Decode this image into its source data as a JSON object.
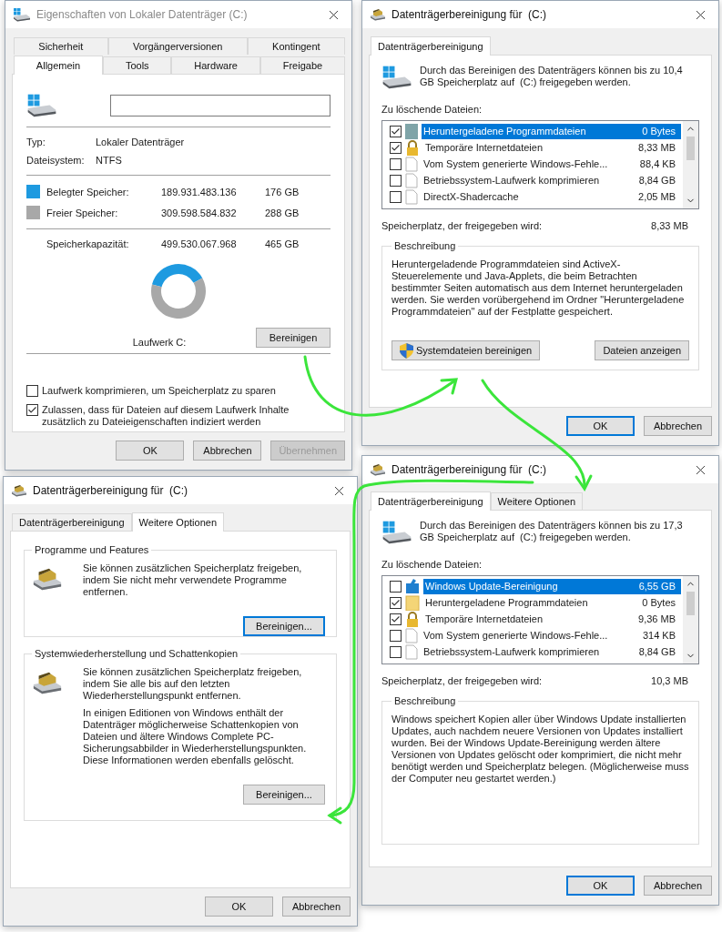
{
  "windows": [
    {
      "kind": "properties",
      "title": "Eigenschaften von Lokaler Datenträger (C:)",
      "tab_rows": [
        [
          {
            "label": "Sicherheit",
            "selected": false
          },
          {
            "label": "Vorgängerversionen",
            "selected": false
          },
          {
            "label": "Kontingent",
            "selected": false
          }
        ],
        [
          {
            "label": "Allgemein",
            "selected": true
          },
          {
            "label": "Tools",
            "selected": false
          },
          {
            "label": "Hardware",
            "selected": false
          },
          {
            "label": "Freigabe",
            "selected": false
          }
        ]
      ],
      "info": [
        {
          "label": "Typ:",
          "value": "Lokaler Datenträger"
        },
        {
          "label": "Dateisystem:",
          "value": "NTFS"
        }
      ],
      "usage": [
        {
          "label": "Belegter Speicher:",
          "color": "#1e9ae0",
          "bytes": "189.931.483.136",
          "size": "176 GB"
        },
        {
          "label": "Freier Speicher:",
          "color": "#a8a8a8",
          "bytes": "309.598.584.832",
          "size": "288 GB"
        }
      ],
      "capacity": {
        "label": "Speicherkapazität:",
        "bytes": "499.530.067.968",
        "size": "465 GB"
      },
      "chart_data": {
        "type": "donut",
        "values": [
          38,
          62
        ]
      },
      "drive_label": "Laufwerk C:",
      "cleanup_button": "Bereinigen",
      "options": [
        {
          "label": "Laufwerk komprimieren, um Speicherplatz zu sparen",
          "checked": false
        },
        {
          "label": "Zulassen, dass für Dateien auf diesem Laufwerk Inhalte zusätzlich zu Dateieigenschaften indiziert werden",
          "checked": true
        }
      ],
      "buttons": [
        {
          "label": "OK",
          "disabled": false
        },
        {
          "label": "Abbrechen",
          "disabled": false
        },
        {
          "label": "Übernehmen",
          "disabled": true
        }
      ]
    },
    {
      "kind": "cleanup",
      "title": "Datenträgerbereinigung für  (C:)",
      "tabs": [
        {
          "label": "Datenträgerbereinigung",
          "selected": true
        }
      ],
      "intro": "Durch das Bereinigen des Datenträgers können bis zu 10,4 GB Speicherplatz auf  (C:) freigegeben werden.",
      "files_label": "Zu löschende Dateien:",
      "files": [
        {
          "kind": "tile",
          "name": "Heruntergeladene Programmdateien",
          "size": "0 Bytes",
          "checked": true,
          "selected": true
        },
        {
          "kind": "lock",
          "name": "Temporäre Internetdateien",
          "size": "8,33 MB",
          "checked": true,
          "selected": false
        },
        {
          "kind": "page",
          "name": "Vom System generierte Windows-Fehle...",
          "size": "88,4 KB",
          "checked": false,
          "selected": false
        },
        {
          "kind": "page",
          "name": "Betriebssystem-Laufwerk komprimieren",
          "size": "8,84 GB",
          "checked": false,
          "selected": false
        },
        {
          "kind": "page",
          "name": "DirectX-Shadercache",
          "size": "2,05 MB",
          "checked": false,
          "selected": false
        }
      ],
      "freed_label": "Speicherplatz, der freigegeben wird:",
      "freed": "8,33 MB",
      "description_title": "Beschreibung",
      "description": "Heruntergeladende Programmdateien sind ActiveX-Steuerelemente und Java-Applets, die beim Betrachten bestimmter Seiten automatisch aus dem Internet heruntergeladen werden. Sie werden vorübergehend im Ordner \"Heruntergeladene Programmdateien\" auf der Festplatte gespeichert.",
      "actions": [
        {
          "kind": "elevated",
          "label": "Systemdateien bereinigen"
        },
        {
          "kind": "plain",
          "label": "Dateien anzeigen"
        }
      ],
      "buttons": [
        {
          "label": "OK",
          "focused": true
        },
        {
          "label": "Abbrechen",
          "focused": false
        }
      ]
    },
    {
      "kind": "cleanup",
      "title": "Datenträgerbereinigung für  (C:)",
      "tabs": [
        {
          "label": "Datenträgerbereinigung",
          "selected": true
        },
        {
          "label": "Weitere Optionen",
          "selected": false
        }
      ],
      "intro": "Durch das Bereinigen des Datenträgers können bis zu 17,3 GB Speicherplatz auf  (C:) freigegeben werden.",
      "files_label": "Zu löschende Dateien:",
      "files": [
        {
          "kind": "update",
          "name": "Windows Update-Bereinigung",
          "size": "6,55 GB",
          "checked": false,
          "selected": true
        },
        {
          "kind": "folder",
          "name": "Heruntergeladene Programmdateien",
          "size": "0 Bytes",
          "checked": true,
          "selected": false
        },
        {
          "kind": "lock",
          "name": "Temporäre Internetdateien",
          "size": "9,36 MB",
          "checked": true,
          "selected": false
        },
        {
          "kind": "page",
          "name": "Vom System generierte Windows-Fehle...",
          "size": "314 KB",
          "checked": false,
          "selected": false
        },
        {
          "kind": "page",
          "name": "Betriebssystem-Laufwerk komprimieren",
          "size": "8,84 GB",
          "checked": false,
          "selected": false
        }
      ],
      "freed_label": "Speicherplatz, der freigegeben wird:",
      "freed": "10,3 MB",
      "description_title": "Beschreibung",
      "description": "Windows speichert Kopien aller über Windows Update installierten Updates, auch nachdem neuere Versionen von Updates installiert wurden. Bei der Windows Update-Bereinigung werden ältere Versionen von Updates gelöscht oder komprimiert, die nicht mehr benötigt werden und Speicherplatz belegen. (Möglicherweise muss der Computer neu gestartet werden.)",
      "buttons": [
        {
          "label": "OK",
          "focused": true
        },
        {
          "label": "Abbrechen",
          "focused": false
        }
      ]
    },
    {
      "kind": "more_options",
      "title": "Datenträgerbereinigung für  (C:)",
      "tabs": [
        {
          "label": "Datenträgerbereinigung",
          "selected": false
        },
        {
          "label": "Weitere Optionen",
          "selected": true
        }
      ],
      "groups": [
        {
          "title": "Programme und Features",
          "texts": [
            "Sie können zusätzlichen Speicherplatz freigeben, indem Sie nicht mehr verwendete Programme entfernen."
          ],
          "button": {
            "label": "Bereinigen...",
            "focused": true
          }
        },
        {
          "title": "Systemwiederherstellung und Schattenkopien",
          "texts": [
            "Sie können zusätzlichen Speicherplatz freigeben, indem Sie alle bis auf den letzten Wiederherstellungspunkt entfernen.",
            "In einigen Editionen von Windows enthält der Datenträger möglicherweise Schattenkopien von Dateien und ältere Windows Complete PC-Sicherungsabbilder in Wiederherstellungspunkten. Diese Informationen werden ebenfalls gelöscht."
          ],
          "button": {
            "label": "Bereinigen...",
            "focused": false
          }
        }
      ],
      "buttons": [
        {
          "label": "OK",
          "focused": false
        },
        {
          "label": "Abbrechen",
          "focused": false
        }
      ]
    }
  ]
}
